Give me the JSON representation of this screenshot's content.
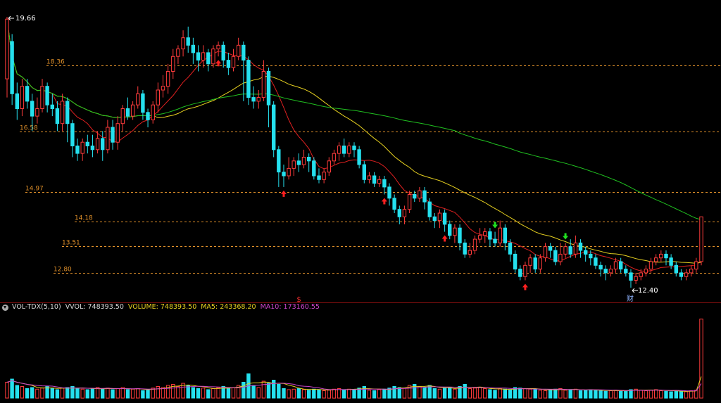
{
  "colors": {
    "up": "#ff3b3b",
    "down": "#25e0ee",
    "ma_red": "#e02020",
    "ma_yellow": "#e6d020",
    "ma_green": "#20c020",
    "level_line": "#e0902a",
    "ma5_vol": "#e6d020",
    "ma10_vol": "#cc44cc",
    "marker_up": "#ff2020",
    "marker_down": "#20e020"
  },
  "main_chart": {
    "high_label": "19.66",
    "low_label": "12.40",
    "event_badge": "财",
    "dividend_marker": "$",
    "levels": [
      {
        "label": "18.36",
        "value": 18.36
      },
      {
        "label": "16.58",
        "value": 16.58
      },
      {
        "label": "14.97",
        "value": 14.97
      },
      {
        "label": "14.18",
        "value": 14.18
      },
      {
        "label": "13.51",
        "value": 13.51
      },
      {
        "label": "12.80",
        "value": 12.8
      }
    ]
  },
  "volume_panel": {
    "indicator": "VOL-TDX(5,10)",
    "vvol_label": "VVOL:",
    "vvol_value": "748393.50",
    "volume_label": "VOLUME:",
    "volume_value": "748393.50",
    "ma5_label": "MA5:",
    "ma5_value": "243368.20",
    "ma10_label": "MA10:",
    "ma10_value": "173160.55"
  },
  "chart_data": {
    "type": "candlestick",
    "y_range": [
      12.1,
      20.0
    ],
    "volume_range": [
      0,
      800000
    ],
    "candles": [
      [
        18.0,
        19.6,
        19.66,
        17.5
      ],
      [
        19.0,
        17.6,
        19.2,
        17.3
      ],
      [
        17.6,
        17.2,
        17.9,
        16.9
      ],
      [
        17.2,
        17.8,
        18.0,
        17.0
      ],
      [
        17.8,
        17.4,
        18.0,
        17.2
      ],
      [
        17.4,
        17.0,
        17.6,
        16.6
      ],
      [
        17.0,
        17.2,
        17.5,
        16.8
      ],
      [
        17.2,
        17.8,
        18.0,
        17.1
      ],
      [
        17.8,
        17.3,
        17.9,
        17.1
      ],
      [
        17.3,
        17.2,
        17.6,
        17.0
      ],
      [
        17.2,
        16.8,
        17.4,
        16.6
      ],
      [
        16.8,
        17.4,
        17.6,
        16.6
      ],
      [
        17.4,
        16.8,
        17.5,
        16.3
      ],
      [
        16.8,
        16.2,
        16.9,
        15.9
      ],
      [
        16.2,
        16.0,
        16.4,
        15.8
      ],
      [
        16.0,
        16.3,
        16.4,
        15.8
      ],
      [
        16.3,
        16.2,
        16.5,
        16.0
      ],
      [
        16.2,
        16.1,
        16.5,
        15.9
      ],
      [
        16.1,
        16.4,
        16.6,
        16.0
      ],
      [
        16.4,
        16.1,
        16.6,
        15.8
      ],
      [
        16.1,
        16.7,
        16.9,
        16.0
      ],
      [
        16.7,
        16.3,
        16.9,
        16.1
      ],
      [
        16.3,
        16.8,
        17.0,
        16.1
      ],
      [
        16.8,
        17.2,
        17.3,
        16.6
      ],
      [
        17.2,
        17.0,
        17.5,
        16.9
      ],
      [
        17.0,
        17.3,
        17.4,
        16.9
      ],
      [
        17.3,
        17.6,
        17.8,
        17.2
      ],
      [
        17.6,
        17.1,
        17.7,
        16.9
      ],
      [
        17.1,
        16.9,
        17.2,
        16.7
      ],
      [
        16.9,
        17.3,
        17.4,
        16.8
      ],
      [
        17.3,
        17.7,
        17.9,
        17.1
      ],
      [
        17.7,
        17.8,
        18.1,
        17.5
      ],
      [
        17.8,
        18.2,
        18.4,
        17.6
      ],
      [
        18.2,
        18.6,
        18.8,
        18.0
      ],
      [
        18.6,
        18.8,
        18.9,
        18.4
      ],
      [
        18.8,
        19.1,
        19.3,
        18.6
      ],
      [
        19.1,
        18.9,
        19.4,
        18.7
      ],
      [
        18.9,
        18.7,
        19.1,
        18.4
      ],
      [
        18.7,
        18.5,
        18.9,
        18.2
      ],
      [
        18.5,
        18.7,
        18.9,
        18.3
      ],
      [
        18.7,
        18.4,
        18.8,
        18.2
      ],
      [
        18.4,
        18.8,
        18.9,
        18.3
      ],
      [
        18.8,
        18.9,
        19.0,
        18.6
      ],
      [
        18.9,
        18.5,
        19.0,
        18.3
      ],
      [
        18.5,
        18.3,
        18.7,
        18.1
      ],
      [
        18.3,
        18.6,
        18.8,
        18.2
      ],
      [
        18.6,
        18.9,
        19.1,
        18.5
      ],
      [
        18.9,
        18.5,
        19.0,
        17.4
      ],
      [
        18.5,
        17.5,
        18.6,
        17.3
      ],
      [
        17.5,
        17.4,
        17.8,
        17.2
      ],
      [
        17.4,
        17.5,
        17.7,
        17.2
      ],
      [
        17.5,
        18.2,
        18.5,
        17.4
      ],
      [
        18.2,
        17.3,
        18.3,
        16.7
      ],
      [
        17.3,
        16.1,
        17.4,
        15.9
      ],
      [
        16.1,
        15.5,
        16.2,
        15.1
      ],
      [
        15.5,
        15.4,
        15.7,
        15.1
      ],
      [
        15.4,
        15.6,
        15.9,
        15.3
      ],
      [
        15.6,
        15.8,
        15.9,
        15.4
      ],
      [
        15.8,
        15.7,
        16.0,
        15.5
      ],
      [
        15.7,
        15.9,
        16.1,
        15.6
      ],
      [
        15.9,
        15.8,
        16.0,
        15.5
      ],
      [
        15.8,
        15.4,
        15.9,
        15.3
      ],
      [
        15.4,
        15.3,
        15.6,
        15.2
      ],
      [
        15.3,
        15.5,
        15.6,
        15.2
      ],
      [
        15.5,
        15.8,
        15.9,
        15.4
      ],
      [
        15.8,
        16.0,
        16.1,
        15.7
      ],
      [
        16.0,
        16.2,
        16.3,
        15.8
      ],
      [
        16.2,
        16.0,
        16.4,
        15.9
      ],
      [
        16.0,
        16.2,
        16.3,
        15.9
      ],
      [
        16.2,
        16.1,
        16.3,
        15.9
      ],
      [
        16.1,
        15.7,
        16.2,
        15.6
      ],
      [
        15.7,
        15.3,
        15.8,
        15.2
      ],
      [
        15.3,
        15.4,
        15.5,
        15.2
      ],
      [
        15.4,
        15.2,
        15.5,
        15.1
      ],
      [
        15.2,
        15.3,
        15.4,
        15.1
      ],
      [
        15.3,
        15.1,
        15.4,
        14.9
      ],
      [
        15.1,
        14.8,
        15.2,
        14.6
      ],
      [
        14.8,
        14.5,
        14.9,
        14.4
      ],
      [
        14.5,
        14.3,
        14.6,
        14.1
      ],
      [
        14.3,
        14.5,
        14.6,
        14.1
      ],
      [
        14.5,
        14.9,
        15.0,
        14.4
      ],
      [
        14.9,
        14.8,
        15.0,
        14.7
      ],
      [
        14.8,
        15.0,
        15.1,
        14.7
      ],
      [
        15.0,
        14.7,
        15.1,
        14.5
      ],
      [
        14.7,
        14.3,
        14.8,
        14.2
      ],
      [
        14.3,
        14.2,
        14.4,
        14.0
      ],
      [
        14.2,
        14.4,
        14.5,
        14.0
      ],
      [
        14.4,
        14.1,
        14.5,
        13.9
      ],
      [
        14.1,
        13.8,
        14.2,
        13.7
      ],
      [
        13.8,
        14.0,
        14.1,
        13.6
      ],
      [
        14.0,
        13.6,
        14.1,
        13.4
      ],
      [
        13.6,
        13.3,
        13.7,
        13.2
      ],
      [
        13.3,
        13.4,
        13.6,
        13.2
      ],
      [
        13.4,
        13.7,
        13.8,
        13.3
      ],
      [
        13.7,
        13.8,
        14.0,
        13.6
      ],
      [
        13.8,
        13.9,
        14.0,
        13.6
      ],
      [
        13.9,
        13.7,
        14.0,
        13.5
      ],
      [
        13.7,
        13.6,
        13.9,
        13.5
      ],
      [
        13.6,
        14.0,
        14.2,
        13.5
      ],
      [
        14.0,
        13.6,
        14.1,
        13.4
      ],
      [
        13.6,
        13.3,
        13.7,
        13.1
      ],
      [
        13.3,
        12.9,
        13.4,
        12.8
      ],
      [
        12.9,
        12.7,
        13.0,
        12.6
      ],
      [
        12.7,
        13.0,
        13.1,
        12.6
      ],
      [
        13.0,
        13.2,
        13.3,
        12.8
      ],
      [
        13.2,
        12.9,
        13.3,
        12.8
      ],
      [
        12.9,
        13.2,
        13.3,
        12.8
      ],
      [
        13.2,
        13.5,
        13.6,
        13.1
      ],
      [
        13.5,
        13.4,
        13.6,
        13.2
      ],
      [
        13.4,
        13.1,
        13.5,
        13.0
      ],
      [
        13.1,
        13.3,
        13.6,
        13.0
      ],
      [
        13.3,
        13.5,
        13.6,
        13.2
      ],
      [
        13.5,
        13.3,
        13.7,
        13.2
      ],
      [
        13.3,
        13.6,
        13.8,
        13.2
      ],
      [
        13.6,
        13.4,
        13.7,
        13.2
      ],
      [
        13.4,
        13.3,
        13.5,
        13.1
      ],
      [
        13.3,
        13.2,
        13.4,
        13.0
      ],
      [
        13.2,
        13.0,
        13.3,
        12.9
      ],
      [
        13.0,
        12.9,
        13.1,
        12.7
      ],
      [
        12.9,
        12.8,
        13.0,
        12.6
      ],
      [
        12.8,
        12.9,
        13.0,
        12.7
      ],
      [
        12.9,
        13.1,
        13.2,
        12.8
      ],
      [
        13.1,
        12.9,
        13.2,
        12.8
      ],
      [
        12.9,
        12.8,
        13.0,
        12.7
      ],
      [
        12.8,
        12.6,
        12.9,
        12.4
      ],
      [
        12.6,
        12.7,
        12.8,
        12.5
      ],
      [
        12.7,
        12.8,
        12.9,
        12.6
      ],
      [
        12.8,
        12.9,
        13.0,
        12.7
      ],
      [
        12.9,
        13.1,
        13.2,
        12.8
      ],
      [
        13.1,
        13.2,
        13.3,
        13.0
      ],
      [
        13.2,
        13.3,
        13.4,
        13.1
      ],
      [
        13.3,
        13.2,
        13.4,
        13.0
      ],
      [
        13.2,
        13.0,
        13.3,
        12.9
      ],
      [
        13.0,
        12.8,
        13.1,
        12.7
      ],
      [
        12.8,
        12.7,
        12.9,
        12.6
      ],
      [
        12.7,
        12.8,
        12.9,
        12.6
      ],
      [
        12.8,
        12.9,
        13.0,
        12.7
      ],
      [
        12.9,
        13.1,
        13.2,
        12.8
      ],
      [
        13.1,
        14.3,
        14.3,
        13.0
      ]
    ],
    "volumes": [
      150000,
      180000,
      120000,
      110000,
      90000,
      100000,
      85000,
      95000,
      110000,
      90000,
      80000,
      95000,
      100000,
      110000,
      90000,
      85000,
      80000,
      90000,
      100000,
      85000,
      95000,
      80000,
      90000,
      100000,
      80000,
      85000,
      90000,
      70000,
      75000,
      95000,
      110000,
      100000,
      120000,
      130000,
      110000,
      140000,
      120000,
      100000,
      90000,
      95000,
      80000,
      90000,
      100000,
      110000,
      90000,
      100000,
      120000,
      150000,
      230000,
      120000,
      100000,
      160000,
      140000,
      170000,
      130000,
      90000,
      80000,
      85000,
      90000,
      80000,
      75000,
      85000,
      80000,
      70000,
      75000,
      85000,
      90000,
      80000,
      85000,
      80000,
      95000,
      110000,
      75000,
      70000,
      80000,
      85000,
      95000,
      110000,
      100000,
      95000,
      120000,
      130000,
      110000,
      100000,
      120000,
      90000,
      85000,
      95000,
      100000,
      85000,
      110000,
      130000,
      90000,
      95000,
      100000,
      90000,
      80000,
      75000,
      90000,
      85000,
      80000,
      100000,
      95000,
      90000,
      85000,
      80000,
      75000,
      70000,
      80000,
      85000,
      90000,
      75000,
      80000,
      85000,
      70000,
      75000,
      80000,
      75000,
      70000,
      65000,
      70000,
      75000,
      70000,
      65000,
      80000,
      85000,
      75000,
      70000,
      75000,
      80000,
      70000,
      65000,
      60000,
      70000,
      65000,
      60000,
      70000,
      75000,
      748393.5
    ],
    "signals": [
      {
        "index": 42,
        "kind": "buy",
        "label": ""
      },
      {
        "index": 55,
        "kind": "buy",
        "label": ""
      },
      {
        "index": 75,
        "kind": "buy",
        "label": ""
      },
      {
        "index": 87,
        "kind": "buy",
        "label": ""
      },
      {
        "index": 103,
        "kind": "buy",
        "label": ""
      },
      {
        "index": 97,
        "kind": "sell",
        "label": ""
      },
      {
        "index": 111,
        "kind": "sell",
        "label": ""
      }
    ],
    "dividend_index": 58,
    "event_index": 124
  }
}
